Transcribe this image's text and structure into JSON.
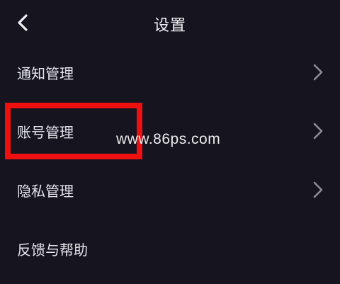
{
  "header": {
    "title": "设置",
    "back_icon": "chevron-left-icon"
  },
  "menu": {
    "items": [
      {
        "label": "通知管理",
        "icon": "chevron-right-icon"
      },
      {
        "label": "账号管理",
        "icon": "chevron-right-icon"
      },
      {
        "label": "隐私管理",
        "icon": "chevron-right-icon"
      },
      {
        "label": "反馈与帮助"
      }
    ]
  },
  "annotation": {
    "highlight_color": "#ee0f0f"
  },
  "watermark": {
    "text": "www.86ps.com"
  },
  "colors": {
    "background": "#15141f",
    "text": "#e6e6ec",
    "chevron": "#8c8c96"
  }
}
